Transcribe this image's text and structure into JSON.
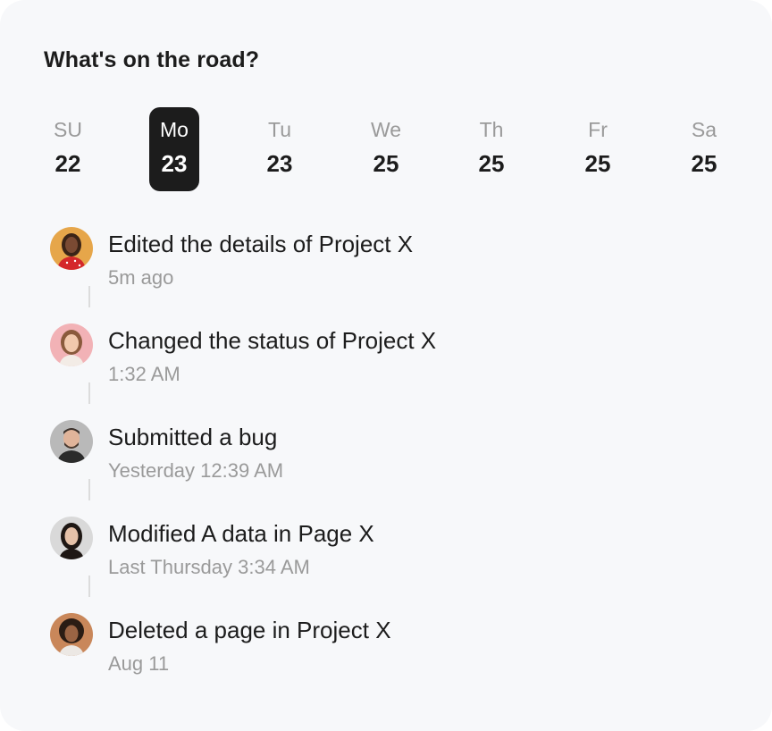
{
  "card": {
    "title": "What's on the road?"
  },
  "calendar": {
    "days": [
      {
        "name": "SU",
        "number": "22",
        "selected": false
      },
      {
        "name": "Mo",
        "number": "23",
        "selected": true
      },
      {
        "name": "Tu",
        "number": "23",
        "selected": false
      },
      {
        "name": "We",
        "number": "25",
        "selected": false
      },
      {
        "name": "Th",
        "number": "25",
        "selected": false
      },
      {
        "name": "Fr",
        "number": "25",
        "selected": false
      },
      {
        "name": "Sa",
        "number": "25",
        "selected": false
      }
    ]
  },
  "activities": [
    {
      "text": "Edited the details of Project X",
      "time": "5m ago",
      "avatar": "avatar-woman-red-dress"
    },
    {
      "text": "Changed the status of Project X",
      "time": "1:32 AM",
      "avatar": "avatar-woman-pink-background"
    },
    {
      "text": "Submitted a bug",
      "time": "Yesterday 12:39 AM",
      "avatar": "avatar-man-grey-background"
    },
    {
      "text": "Modified A data in Page X",
      "time": "Last Thursday 3:34 AM",
      "avatar": "avatar-woman-dark-hair"
    },
    {
      "text": "Deleted a page in Project X",
      "time": "Aug 11",
      "avatar": "avatar-woman-curly-hair"
    }
  ],
  "colors": {
    "card_background": "#f7f8fa",
    "selected_day_background": "#1c1c1c",
    "primary_text": "#1c1c1c",
    "secondary_text": "#9a9a9a",
    "connector": "#dcdcdc"
  }
}
